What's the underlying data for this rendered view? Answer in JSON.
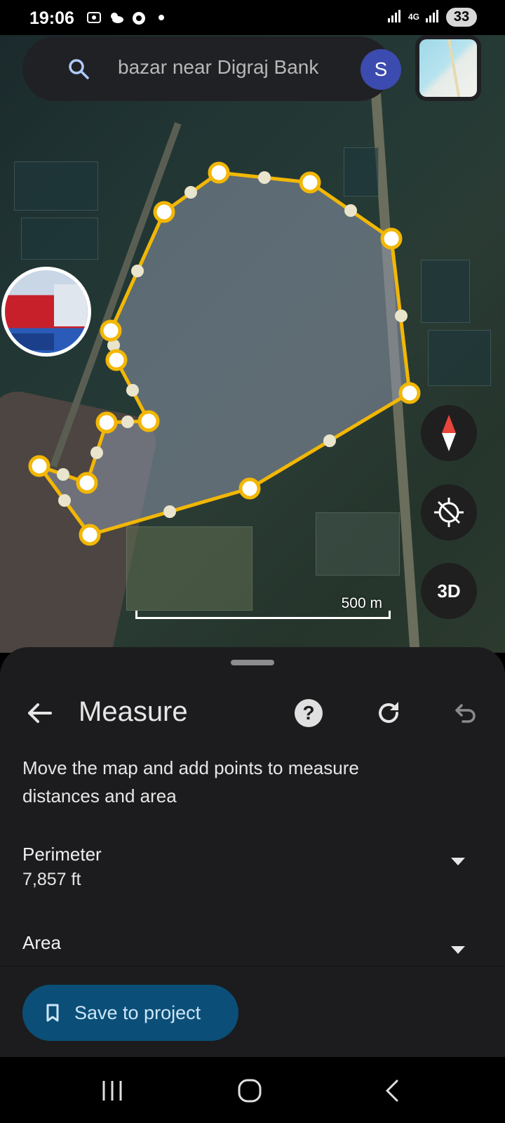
{
  "status_bar": {
    "time": "19:06",
    "network": "4G",
    "battery": "33"
  },
  "search": {
    "query": "bazar near Digraj Bank",
    "avatar_letter": "S"
  },
  "map": {
    "scale_label": "500 m",
    "threed_label": "3D",
    "colors": {
      "polygon_outline": "#f2b705",
      "vertex_fill": "#ffffff",
      "midpoint_fill": "#e9e4cc",
      "polygon_fill": "rgba(140,150,170,0.55)"
    }
  },
  "measure": {
    "title": "Measure",
    "help_label": "?",
    "instructions": "Move the map and add points to measure distances and area",
    "perimeter_label": "Perimeter",
    "perimeter_value": "7,857 ft",
    "area_label": "Area",
    "save_label": "Save to project"
  },
  "icons": {
    "search": "search-icon",
    "back": "arrow-left-icon",
    "help": "help-circle-icon",
    "reset": "refresh-icon",
    "undo": "undo-icon",
    "compass": "compass-icon",
    "locate": "location-disabled-icon",
    "save": "bookmark-icon",
    "expand": "chevron-down-icon"
  }
}
